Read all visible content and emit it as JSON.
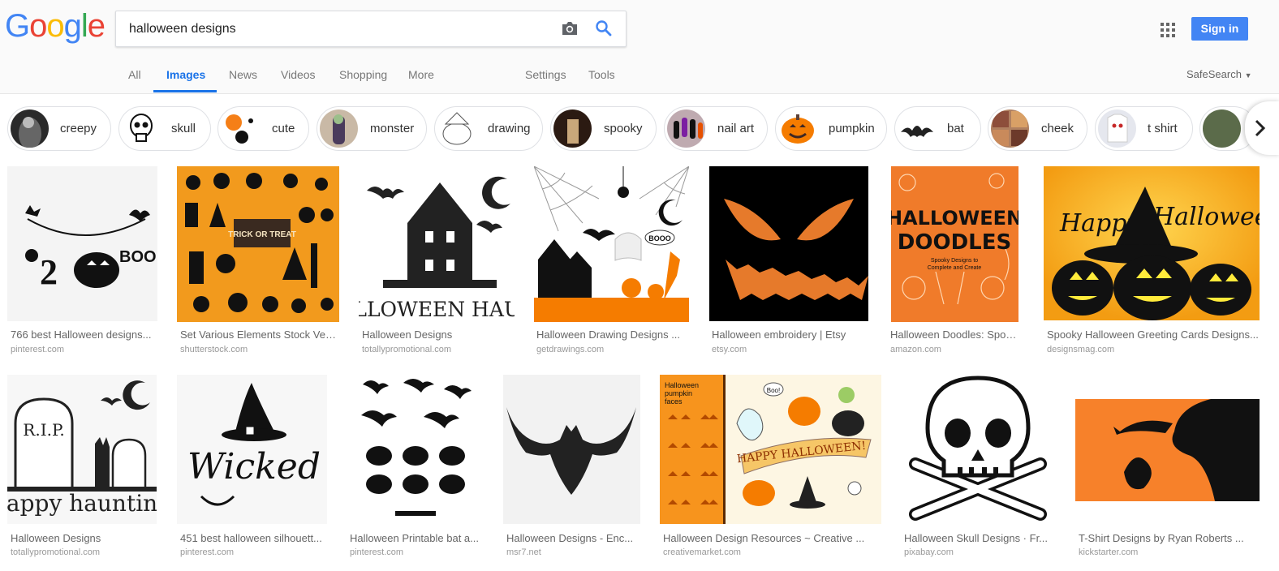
{
  "logo": {
    "letters": [
      "G",
      "o",
      "o",
      "g",
      "l",
      "e"
    ],
    "colors": [
      "#4285f4",
      "#ea4335",
      "#fbbc05",
      "#4285f4",
      "#34a853",
      "#ea4335"
    ]
  },
  "search": {
    "query": "halloween designs"
  },
  "header": {
    "signin_label": "Sign in"
  },
  "tabs": [
    {
      "label": "All"
    },
    {
      "label": "Images"
    },
    {
      "label": "News"
    },
    {
      "label": "Videos"
    },
    {
      "label": "Shopping"
    },
    {
      "label": "More"
    },
    {
      "label": "Settings"
    },
    {
      "label": "Tools"
    }
  ],
  "safesearch": {
    "label": "SafeSearch"
  },
  "chips": [
    {
      "label": "creepy"
    },
    {
      "label": "skull"
    },
    {
      "label": "cute"
    },
    {
      "label": "monster"
    },
    {
      "label": "drawing"
    },
    {
      "label": "spooky"
    },
    {
      "label": "nail art"
    },
    {
      "label": "pumpkin"
    },
    {
      "label": "bat"
    },
    {
      "label": "cheek"
    },
    {
      "label": "t shirt"
    }
  ],
  "results": [
    {
      "title": "766 best Halloween designs...",
      "source": "pinterest.com"
    },
    {
      "title": "Set Various Elements Stock Vec...",
      "source": "shutterstock.com"
    },
    {
      "title": "Halloween Designs",
      "source": "totallypromotional.com"
    },
    {
      "title": "Halloween Drawing Designs ...",
      "source": "getdrawings.com"
    },
    {
      "title": "Halloween embroidery | Etsy",
      "source": "etsy.com"
    },
    {
      "title": "Halloween Doodles: Spoo...",
      "source": "amazon.com"
    },
    {
      "title": "Spooky Halloween Greeting Cards Designs...",
      "source": "designsmag.com"
    },
    {
      "title": "Halloween Designs",
      "source": "totallypromotional.com"
    },
    {
      "title": "451 best halloween silhouett...",
      "source": "pinterest.com"
    },
    {
      "title": "Halloween Printable bat a...",
      "source": "pinterest.com"
    },
    {
      "title": "Halloween Designs - Enc...",
      "source": "msr7.net"
    },
    {
      "title": "Halloween Design Resources ~ Creative ...",
      "source": "creativemarket.com"
    },
    {
      "title": "Halloween Skull Designs · Fr...",
      "source": "pixabay.com"
    },
    {
      "title": "T-Shirt Designs by Ryan Roberts ...",
      "source": "kickstarter.com"
    }
  ],
  "image_text": {
    "trick": "TRICK OR TREAT",
    "haunt": "HALLOWEEN HAUNT",
    "booo": "BOOO",
    "boo": "BOO!",
    "doodles_1": "HALLOWEEN",
    "doodles_2": "DOODLES",
    "doodles_sub_1": "Spooky Designs to",
    "doodles_sub_2": "Complete and Create",
    "happy": "Happy",
    "halloween": "Halloween",
    "rip": "R.I.P.",
    "happy_haunting": "happy haunting",
    "wicked": "Wicked",
    "pumpkin_faces_1": "Halloween",
    "pumpkin_faces_2": "pumpkin",
    "pumpkin_faces_3": "faces",
    "happy_halloween_banner": "HAPPY HALLOWEEN!",
    "boo_small": "Boo!"
  }
}
